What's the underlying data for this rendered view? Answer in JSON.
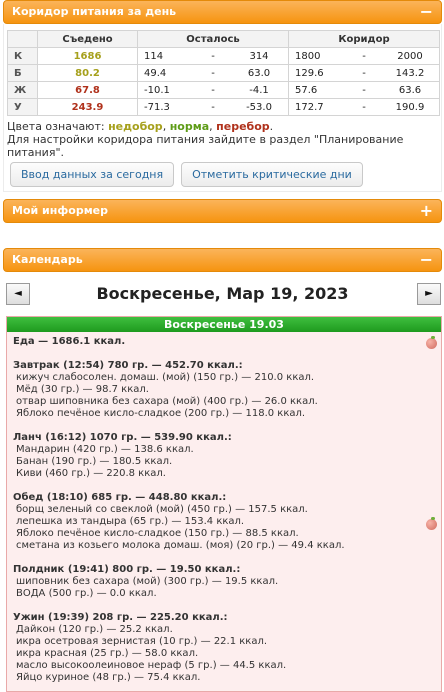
{
  "corridor_panel": {
    "title": "Коридор питания за день",
    "collapse_icon": "minus-icon",
    "columns": [
      "",
      "Съедено",
      "Осталось",
      "Коридор"
    ],
    "rows": [
      {
        "label": "К",
        "eaten": "1686",
        "eaten_status": "under",
        "rem_from": "114",
        "rem_sep": "-",
        "rem_to": "314",
        "cor_from": "1800",
        "cor_sep": "-",
        "cor_to": "2000"
      },
      {
        "label": "Б",
        "eaten": "80.2",
        "eaten_status": "under",
        "rem_from": "49.4",
        "rem_sep": "-",
        "rem_to": "63.0",
        "cor_from": "129.6",
        "cor_sep": "-",
        "cor_to": "143.2"
      },
      {
        "label": "Ж",
        "eaten": "67.8",
        "eaten_status": "over",
        "rem_from": "-10.1",
        "rem_sep": "-",
        "rem_to": "-4.1",
        "cor_from": "57.6",
        "cor_sep": "-",
        "cor_to": "63.6"
      },
      {
        "label": "У",
        "eaten": "243.9",
        "eaten_status": "over",
        "rem_from": "-71.3",
        "rem_sep": "-",
        "rem_to": "-53.0",
        "cor_from": "172.7",
        "cor_sep": "-",
        "cor_to": "190.9"
      }
    ],
    "legend_prefix": "Цвета означают:",
    "legend_under": "недобор",
    "legend_comma": ",",
    "legend_norm": "норма",
    "legend_over": "перебор",
    "legend_end": ".",
    "hint": "Для настройки коридора питания зайдите в раздел \"Планирование питания\".",
    "btn_enter": "Ввод данных за сегодня",
    "btn_critical": "Отметить критические дни",
    "colors": {
      "under": "#a6a01c",
      "norm": "#5e9c17",
      "over": "#b0311b",
      "header": "#f69410"
    }
  },
  "informer_panel": {
    "title": "Мой информер",
    "expand_icon": "plus-icon",
    "expand_glyph": "+"
  },
  "calendar_panel": {
    "title": "Календарь",
    "collapse_icon": "minus-icon",
    "collapse_glyph": "−",
    "prev_glyph": "◄",
    "next_glyph": "►",
    "date_title": "Воскресенье, Мар 19, 2023",
    "day_header": "Воскресенье 19.03",
    "total": "Еда — 1686.1 ккал.",
    "meals": [
      {
        "title": "Завтрак (12:54) 780 гр. — 452.70 ккал.:",
        "items": [
          "кижуч слабосолен. домаш. (мой) (150 гр.) — 210.0 ккал.",
          "Мёд (30 гр.) — 98.7 ккал.",
          "отвар шиповника без сахара (мой) (400 гр.) — 26.0 ккал.",
          "Яблоко печёное кисло-сладкое (200 гр.) — 118.0 ккал."
        ]
      },
      {
        "title": "Ланч (16:12) 1070 гр. — 539.90 ккал.:",
        "items": [
          "Мандарин (420 гр.) — 138.6 ккал.",
          "Банан (190 гр.) — 180.5 ккал.",
          "Киви (460 гр.) — 220.8 ккал."
        ]
      },
      {
        "title": "Обед (18:10) 685 гр. — 448.80 ккал.:",
        "items": [
          "борщ зеленый со свеклой (мой) (450 гр.) — 157.5 ккал.",
          "лепешка из тандыра (65 гр.) — 153.4 ккал.",
          "Яблоко печёное кисло-сладкое (150 гр.) — 88.5 ккал.",
          "сметана из козьего молока домаш. (моя) (20 гр.) — 49.4 ккал."
        ]
      },
      {
        "title": "Полдник (19:41) 800 гр. — 19.50 ккал.:",
        "items": [
          "шиповник без сахара (мой) (300 гр.) — 19.5 ккал.",
          "ВОДА (500 гр.) — 0.0 ккал."
        ]
      },
      {
        "title": "Ужин (19:39) 208 гр. — 225.20 ккал.:",
        "items": [
          "Дайкон (120 гр.) — 25.2 ккал.",
          "икра осетровая зернистая (10 гр.) — 22.1 ккал.",
          "икра красная (25 гр.) — 58.0 ккал.",
          "масло высокоолеиновое нераф (5 гр.) — 44.5 ккал.",
          "Яйцо куриное (48 гр.) — 75.4 ккал."
        ]
      }
    ]
  }
}
